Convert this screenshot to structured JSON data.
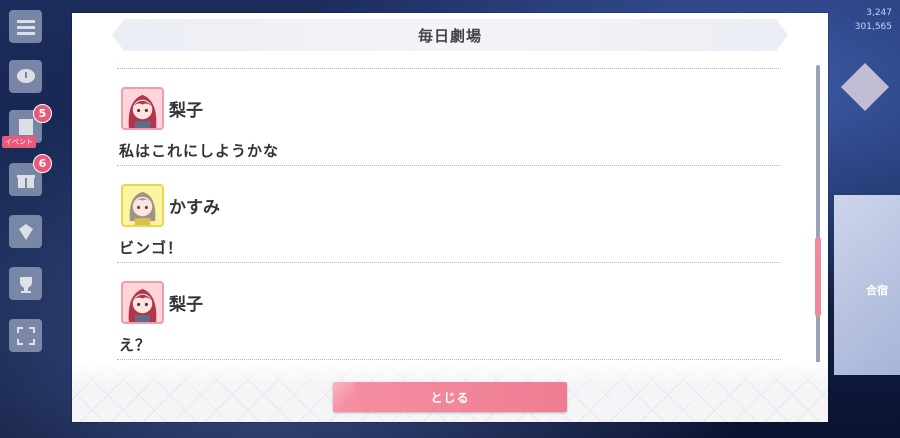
{
  "background": {
    "rail_badges": [
      "5",
      "6"
    ],
    "rail_tag": "イベント",
    "stats": [
      "3,247",
      "301,565"
    ],
    "stage_label": "合宿"
  },
  "modal": {
    "title": "毎日劇場",
    "messages": [
      {
        "speaker": "梨子",
        "avatar": "riko-avatar",
        "text": "私はこれにしようかな"
      },
      {
        "speaker": "かすみ",
        "avatar": "kasumi-avatar",
        "text": "ビンゴ！"
      },
      {
        "speaker": "梨子",
        "avatar": "riko-avatar",
        "text": "え？"
      }
    ],
    "close_label": "とじる"
  },
  "colors": {
    "accent_pink": "#ef7d92",
    "riko_frame": "#f29aae",
    "kasumi_frame": "#e7d84e"
  }
}
